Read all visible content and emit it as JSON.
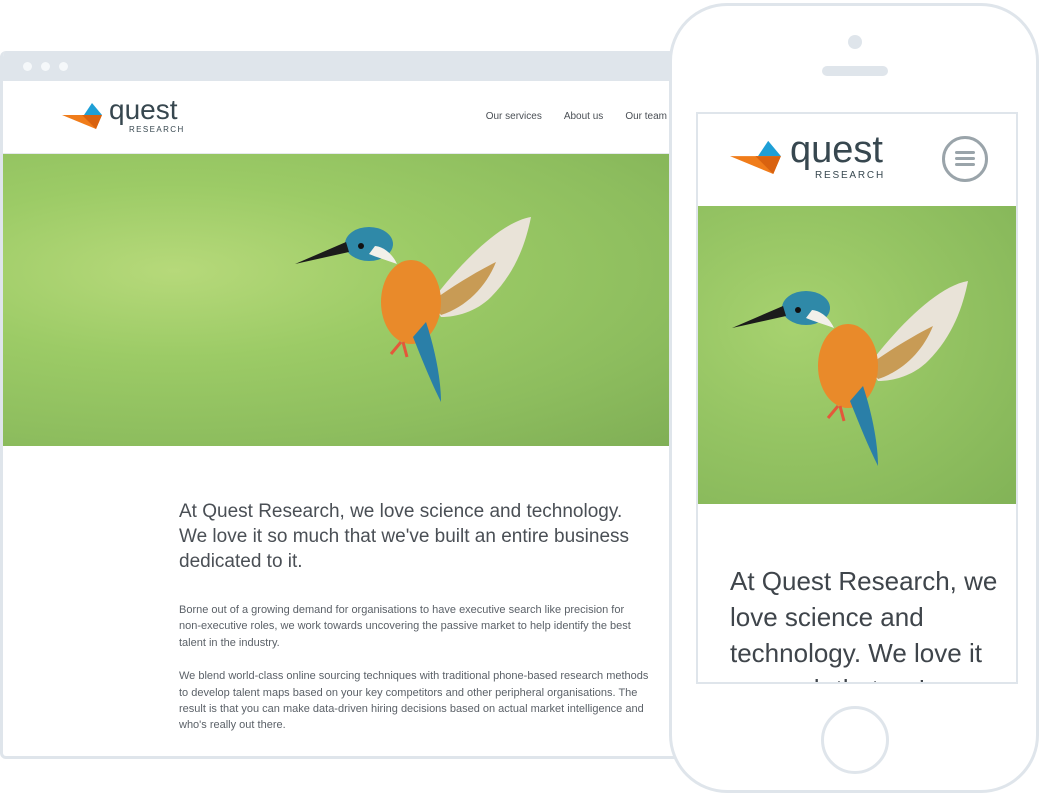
{
  "colors": {
    "logo_orange": "#f07c1a",
    "logo_blue": "#1e9fd6",
    "text_dark": "#37474f",
    "frame_gray": "#dfe5eb",
    "hero_green": "#9ccb66"
  },
  "desktop": {
    "logo": {
      "word": "quest",
      "sub": "RESEARCH"
    },
    "nav": [
      "Our services",
      "About us",
      "Our team"
    ],
    "hero_image": "kingfisher-in-flight",
    "lead": "At Quest Research, we love science and technology. We love it so much that we've built an entire business dedicated to it.",
    "paragraphs": [
      "Borne out of a growing demand for organisations to have executive search like precision for non-executive roles, we work towards uncovering the passive market to help identify the best talent in the industry.",
      "We blend world-class online sourcing techniques with traditional phone-based research methods to develop talent maps based on your key competitors and other peripheral organisations. The result is that you can make data-driven hiring decisions based on actual market intelligence and who's really out there."
    ]
  },
  "mobile": {
    "logo": {
      "word": "quest",
      "sub": "RESEARCH"
    },
    "menu_icon": "hamburger-menu-icon",
    "hero_image": "kingfisher-in-flight",
    "lead": "At Quest Research, we love science and technology. We love it so much that we've"
  }
}
